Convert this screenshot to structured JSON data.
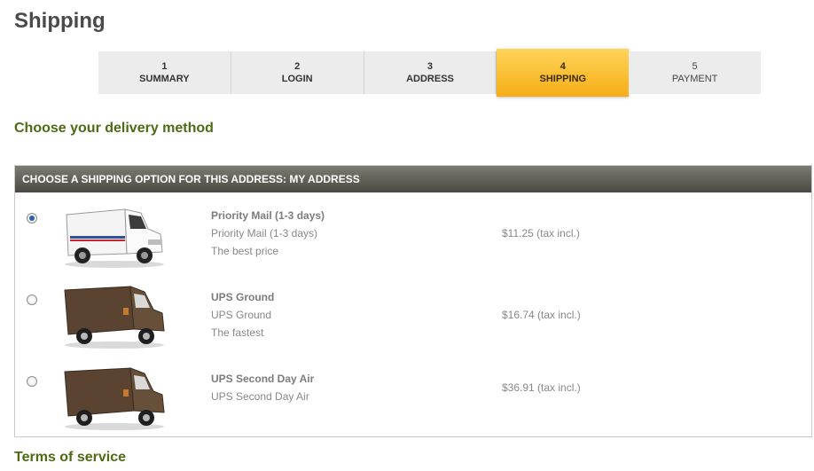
{
  "page": {
    "title": "Shipping"
  },
  "steps": [
    {
      "number": "1",
      "label": "SUMMARY"
    },
    {
      "number": "2",
      "label": "LOGIN"
    },
    {
      "number": "3",
      "label": "ADDRESS"
    },
    {
      "number": "4",
      "label": "SHIPPING"
    },
    {
      "number": "5",
      "label": "PAYMENT"
    }
  ],
  "delivery": {
    "heading": "Choose your delivery method",
    "table_header": "CHOOSE A SHIPPING OPTION FOR THIS ADDRESS: MY ADDRESS",
    "options": [
      {
        "name": "Priority Mail (1-3 days)",
        "delay": "Priority Mail (1-3 days)",
        "note": "The best price",
        "price": "$11.25 (tax incl.)",
        "selected": true,
        "icon": "usps-truck-icon"
      },
      {
        "name": "UPS Ground",
        "delay": "UPS Ground",
        "note": "The fastest",
        "price": "$16.74 (tax incl.)",
        "selected": false,
        "icon": "ups-truck-icon"
      },
      {
        "name": "UPS Second Day Air",
        "delay": "UPS Second Day Air",
        "note": "",
        "price": "$36.91 (tax incl.)",
        "selected": false,
        "icon": "ups-truck-icon"
      }
    ]
  },
  "terms": {
    "heading": "Terms of service"
  },
  "colors": {
    "accent": "#f6ae16",
    "heading_green": "#4c6b12",
    "header_bar": "#4a4a42"
  }
}
